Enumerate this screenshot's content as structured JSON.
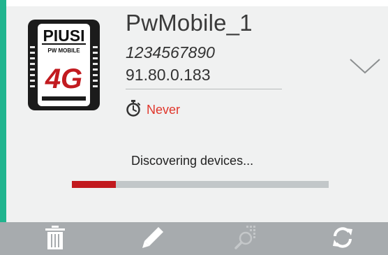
{
  "device": {
    "name": "PwMobile_1",
    "serial": "1234567890",
    "ip": "91.80.0.183",
    "last_sync": "Never",
    "logo_text": {
      "brand": "PIUSI",
      "model": "PW MOBILE",
      "network": "4G"
    }
  },
  "discovery": {
    "status_text": "Discovering devices...",
    "progress_fraction": 0.17
  },
  "colors": {
    "accent": "#20b48e",
    "progress_fill": "#c2191e",
    "progress_track": "#c2c7c9",
    "sync_text": "#e0362b",
    "toolbar_bg": "#a7abae"
  },
  "toolbar": {
    "items": [
      {
        "icon": "trash-icon",
        "enabled": true
      },
      {
        "icon": "pencil-icon",
        "enabled": true
      },
      {
        "icon": "search-grid-icon",
        "enabled": false
      },
      {
        "icon": "refresh-icon",
        "enabled": true
      }
    ]
  }
}
